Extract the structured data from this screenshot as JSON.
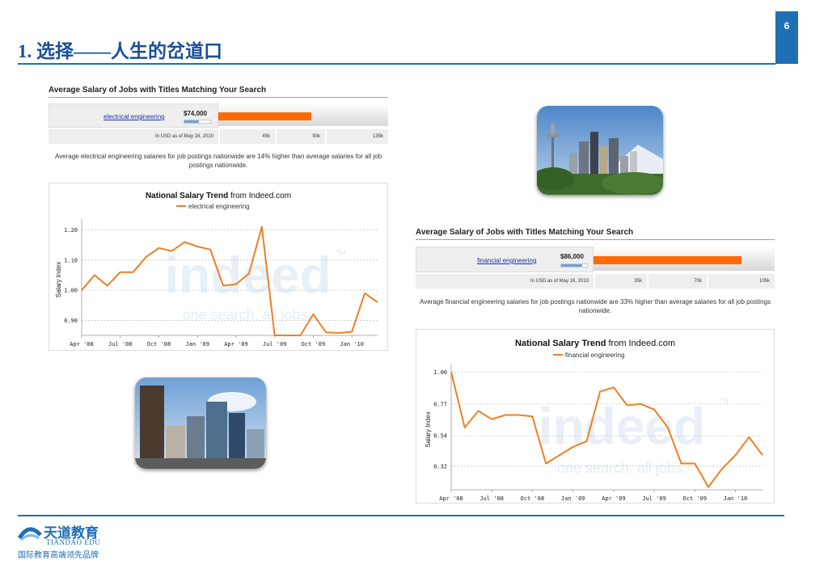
{
  "slide": {
    "page_number": "6",
    "title": "1. 选择——人生的岔道口"
  },
  "left": {
    "heading": "Average Salary of Jobs with Titles Matching Your Search",
    "job_link": "electrical engineering",
    "salary": "$74,000",
    "salary_fraction": 0.548,
    "currency_note": "In USD as of May 16, 2010",
    "scale_ticks": [
      "45k",
      "90k",
      "135k"
    ],
    "description": "Average electrical engineering salaries for job postings nationwide are 14% higher than average salaries for all job postings nationwide."
  },
  "right": {
    "heading": "Average Salary of Jobs with Titles Matching Your Search",
    "job_link": "financial engineering",
    "salary": "$86,000",
    "salary_fraction": 0.819,
    "currency_note": "In USD as of May 16, 2010",
    "scale_ticks": [
      "35k",
      "70k",
      "105k"
    ],
    "description": "Average financial engineering salaries for job postings nationwide are 33% higher than average salaries for all job postings nationwide."
  },
  "watermark": {
    "brand": "indeed",
    "tagline": "one search. all jobs.",
    "tm": "TM"
  },
  "logo": {
    "cn": "天道教育",
    "en": "TIANDAO EDU",
    "tagline": "国际教育高端领先品牌"
  },
  "colors": {
    "accent": "#1f6fb5",
    "series": "#f07f22",
    "bar": "#ff6a00"
  },
  "chart_data": [
    {
      "type": "line",
      "title": "National Salary Trend",
      "title_suffix": "from Indeed.com",
      "ylabel": "Salary Index",
      "xlabel": "",
      "ylim": [
        0.85,
        1.22
      ],
      "yticks": [
        "1.20",
        "1.10",
        "1.00",
        "0.90"
      ],
      "yticks_values": [
        1.2,
        1.1,
        1.0,
        0.9
      ],
      "xticks": [
        "Apr '08",
        "Jul '08",
        "Oct '08",
        "Jan '09",
        "Apr '09",
        "Jul '09",
        "Oct '09",
        "Jan '10"
      ],
      "grid": true,
      "legend": "top-center",
      "series": [
        {
          "name": "electrical engineering",
          "values": [
            1.0,
            1.05,
            1.015,
            1.06,
            1.06,
            1.11,
            1.14,
            1.13,
            1.16,
            1.145,
            1.135,
            1.015,
            1.02,
            1.055,
            1.21,
            0.85,
            0.85,
            0.85,
            0.92,
            0.86,
            0.858,
            0.862,
            0.99,
            0.96
          ]
        }
      ]
    },
    {
      "type": "line",
      "title": "National Salary Trend",
      "title_suffix": "from Indeed.com",
      "ylabel": "Salary Index",
      "xlabel": "",
      "ylim": [
        0.15,
        1.02
      ],
      "yticks": [
        "1.00",
        "0.77",
        "0.54",
        "0.32"
      ],
      "yticks_values": [
        1.0,
        0.77,
        0.54,
        0.32
      ],
      "xticks": [
        "Apr '08",
        "Jul '08",
        "Oct '08",
        "Jan '09",
        "Apr '09",
        "Jul '09",
        "Oct '09",
        "Jan '10"
      ],
      "grid": true,
      "legend": "top-center",
      "series": [
        {
          "name": "financial engineering",
          "values": [
            1.0,
            0.6,
            0.72,
            0.66,
            0.69,
            0.69,
            0.68,
            0.34,
            0.4,
            0.46,
            0.5,
            0.86,
            0.89,
            0.76,
            0.77,
            0.73,
            0.6,
            0.34,
            0.34,
            0.17,
            0.3,
            0.4,
            0.53,
            0.4
          ]
        }
      ]
    }
  ]
}
